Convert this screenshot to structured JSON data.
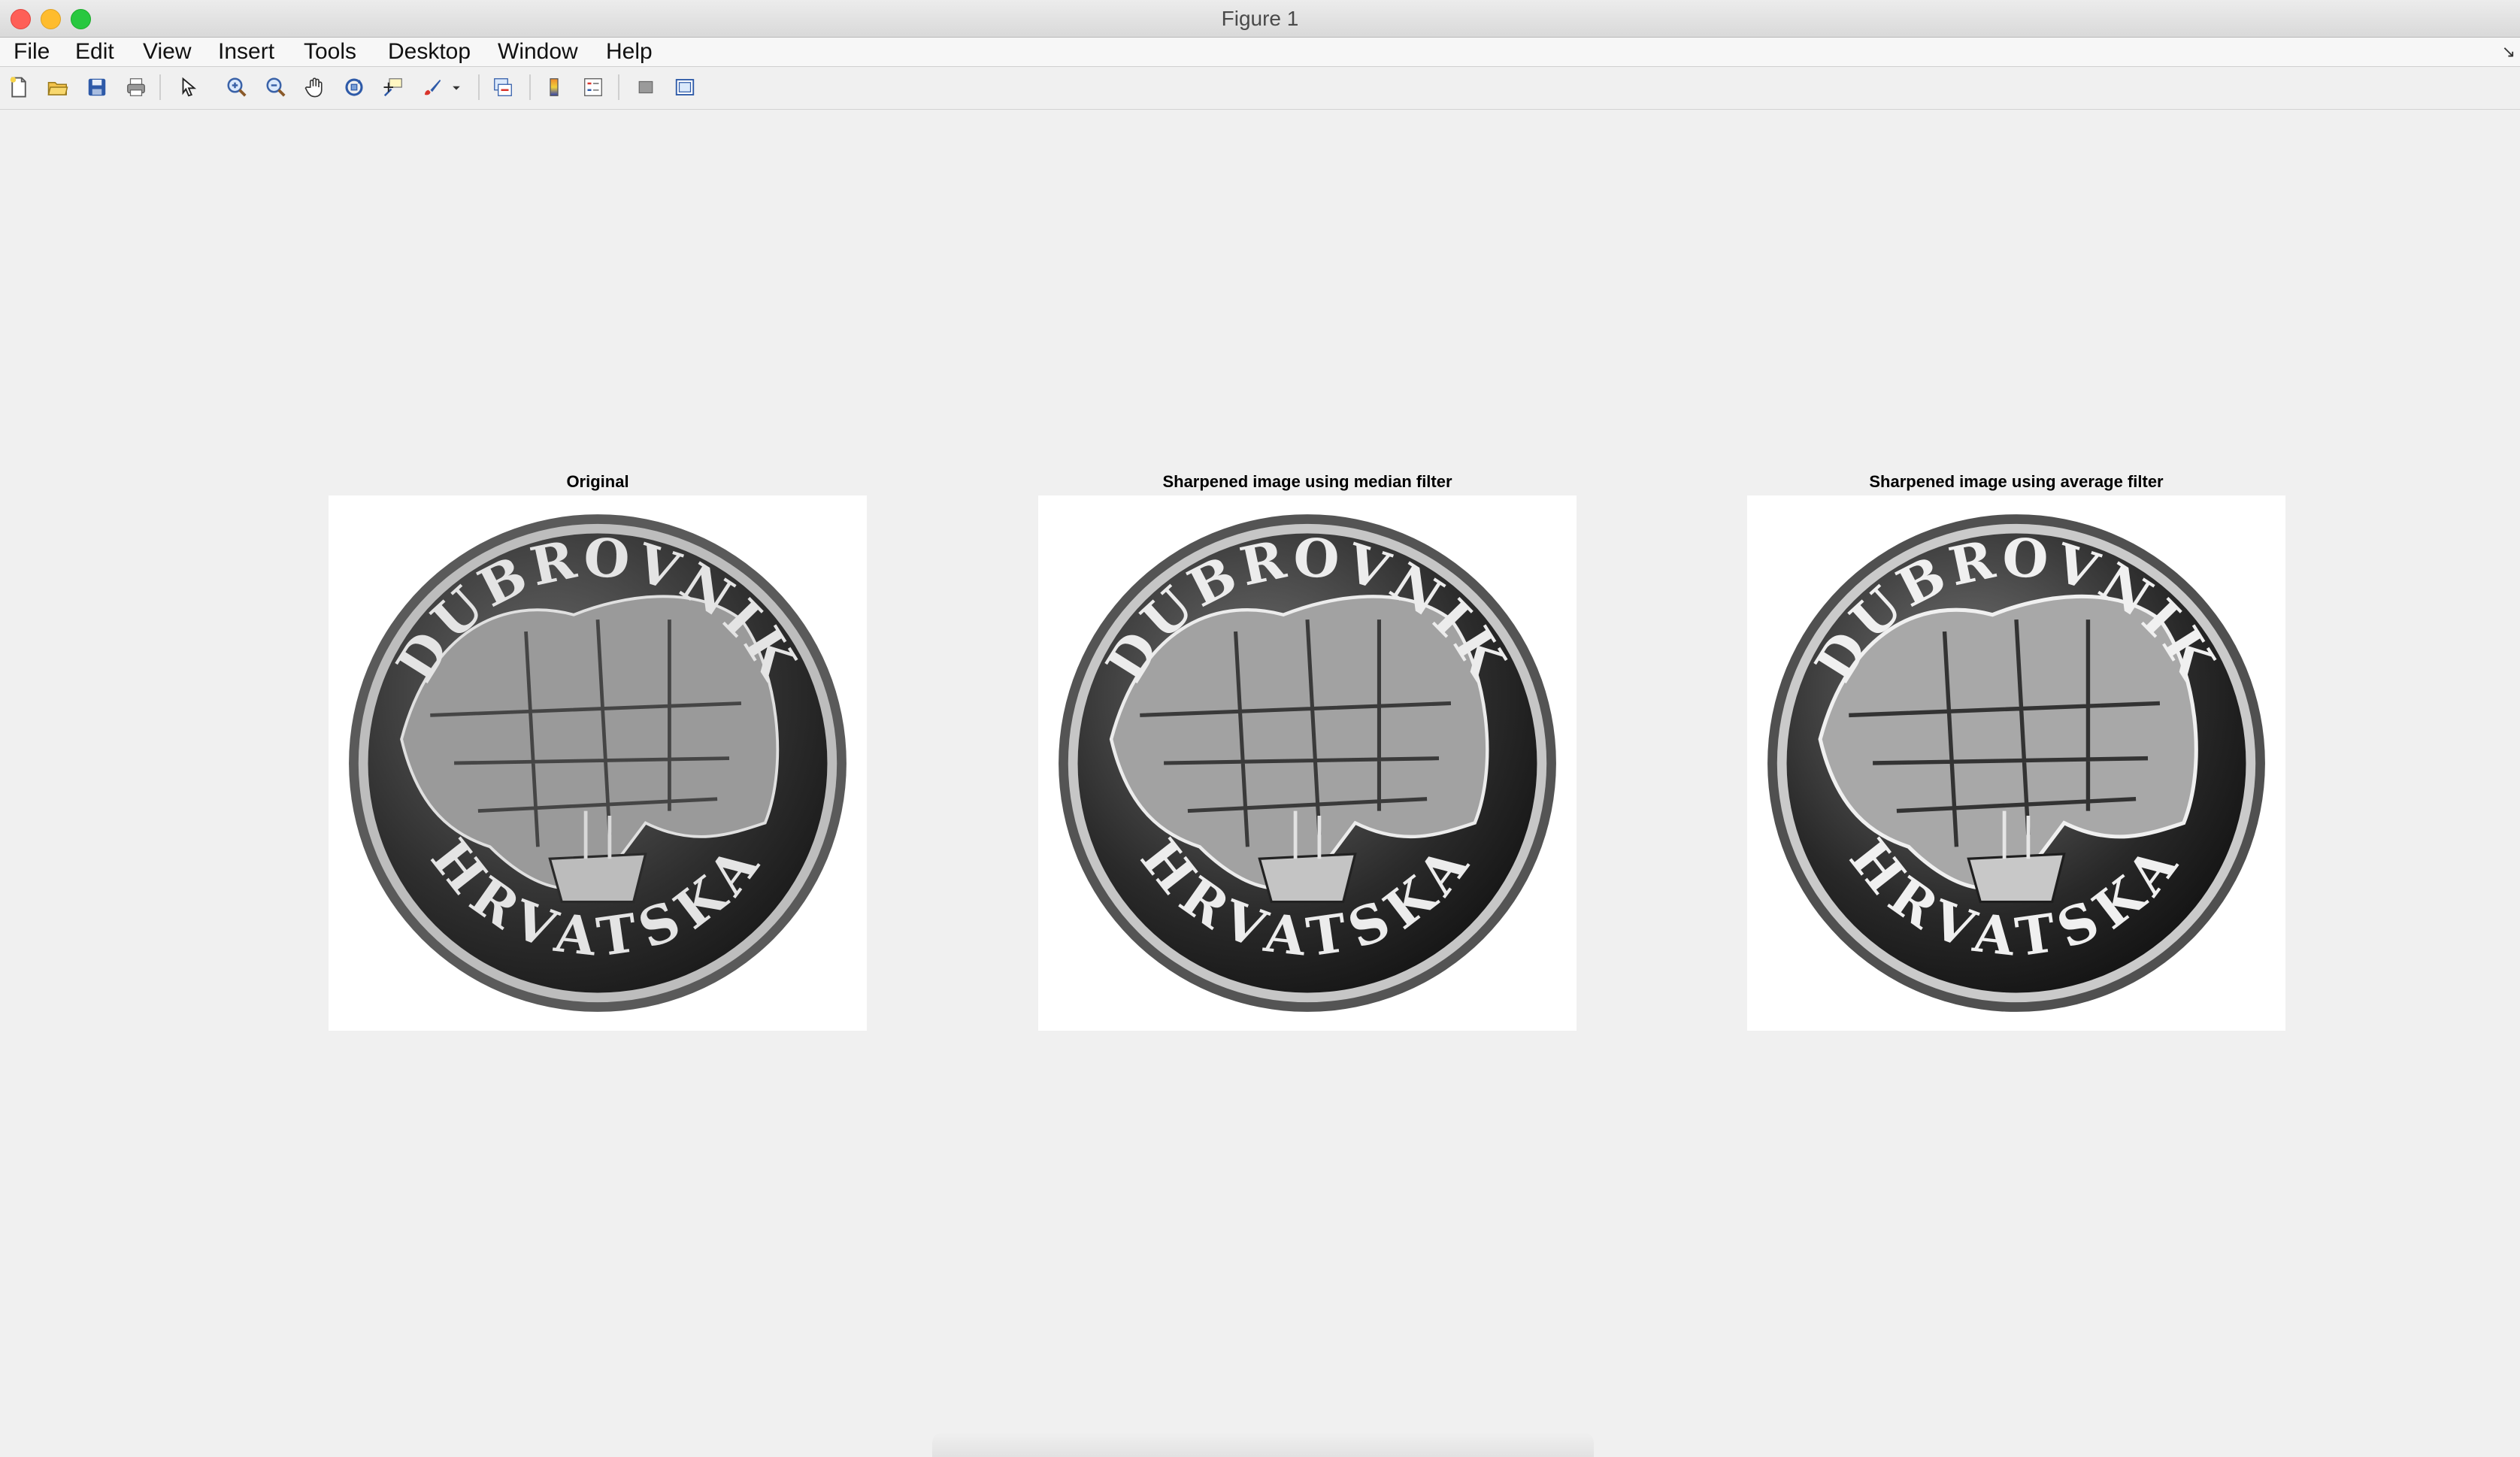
{
  "window": {
    "title": "Figure 1"
  },
  "menu": [
    "File",
    "Edit",
    "View",
    "Insert",
    "Tools",
    "Desktop",
    "Window",
    "Help"
  ],
  "toolbar": {
    "icons": [
      "new-figure-icon",
      "open-file-icon",
      "save-icon",
      "print-icon",
      "select-arrow-icon",
      "zoom-in-icon",
      "zoom-out-icon",
      "pan-hand-icon",
      "rotate-3d-icon",
      "data-cursor-icon",
      "brush-icon",
      "link-plot-icon",
      "colorbar-icon",
      "legend-icon",
      "hide-plot-tools-icon",
      "show-plot-tools-icon"
    ]
  },
  "axes": [
    {
      "title": "Original",
      "coin_top_text": "DUBROVNIK",
      "coin_bottom_text": "HRVATSKA"
    },
    {
      "title": "Sharpened image using median filter",
      "coin_top_text": "DUBROVNIK",
      "coin_bottom_text": "HRVATSKA"
    },
    {
      "title": "Sharpened image using average filter",
      "coin_top_text": "DUBROVNIK",
      "coin_bottom_text": "HRVATSKA"
    }
  ]
}
